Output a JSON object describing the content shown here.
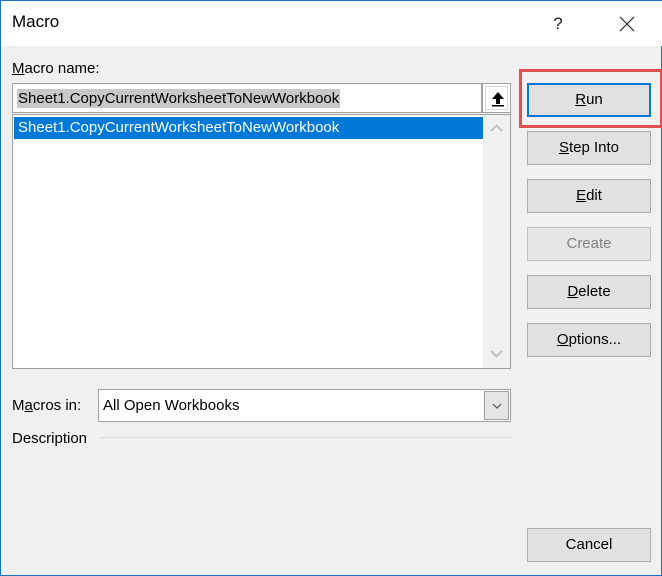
{
  "window": {
    "title": "Macro",
    "help_label": "?",
    "close_icon": "close-icon"
  },
  "macro_name": {
    "label_prefix": "",
    "label_accel": "M",
    "label_rest": "acro name:",
    "value": "Sheet1.CopyCurrentWorksheetToNewWorkbook",
    "upload_icon": "arrow-up-icon"
  },
  "macro_list": {
    "items": [
      {
        "label": "Sheet1.CopyCurrentWorksheetToNewWorkbook",
        "selected": true
      }
    ]
  },
  "buttons": {
    "run": {
      "accel": "R",
      "rest": "un",
      "enabled": true
    },
    "step_into": {
      "accel": "S",
      "rest": "tep Into",
      "enabled": true
    },
    "edit": {
      "accel": "E",
      "rest": "dit",
      "enabled": true
    },
    "create": {
      "label": "Create",
      "enabled": false
    },
    "delete": {
      "accel": "D",
      "rest": "elete",
      "enabled": true
    },
    "options": {
      "accel": "O",
      "rest": "ptions...",
      "enabled": true
    },
    "cancel": {
      "label": "Cancel",
      "enabled": true
    }
  },
  "macros_in": {
    "label_prefix": "M",
    "label_accel": "a",
    "label_rest": "cros in:",
    "selected": "All Open Workbooks"
  },
  "description": {
    "label": "Description"
  },
  "colors": {
    "selection": "#0078d7",
    "highlight_box": "#e05252",
    "window_border": "#1a73c7"
  }
}
